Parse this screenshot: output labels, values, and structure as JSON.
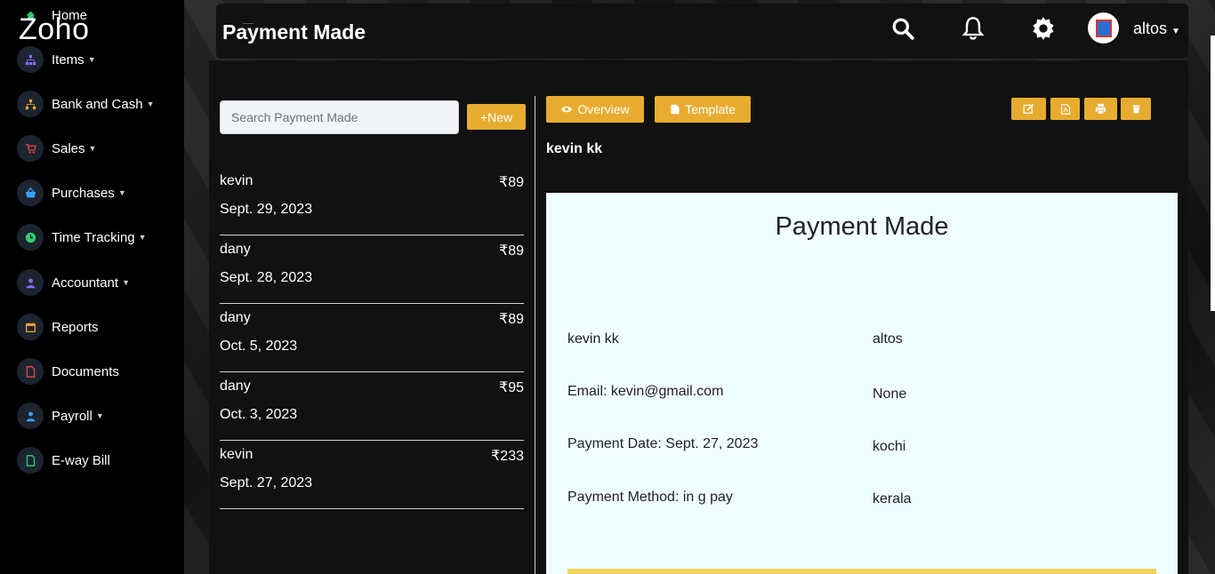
{
  "sidebar": {
    "logo": "Zoho",
    "items": [
      {
        "label": "Home",
        "icon": "home-icon",
        "color": "#2ecc71",
        "caret": false
      },
      {
        "label": "Items",
        "icon": "sitemap-icon",
        "color": "#8a6bf0",
        "caret": true
      },
      {
        "label": "Bank and Cash",
        "icon": "bank-icon",
        "color": "#f0a030",
        "caret": true
      },
      {
        "label": "Sales",
        "icon": "cart-icon",
        "color": "#e84545",
        "caret": true
      },
      {
        "label": "Purchases",
        "icon": "basket-icon",
        "color": "#3aa0ff",
        "caret": true
      },
      {
        "label": "Time Tracking",
        "icon": "clock-icon",
        "color": "#2ecc71",
        "caret": true
      },
      {
        "label": "Accountant",
        "icon": "user-icon",
        "color": "#8a6bf0",
        "caret": true
      },
      {
        "label": "Reports",
        "icon": "calendar-icon",
        "color": "#f0a030",
        "caret": false
      },
      {
        "label": "Documents",
        "icon": "document-icon",
        "color": "#e84545",
        "caret": false
      },
      {
        "label": "Payroll",
        "icon": "person-icon",
        "color": "#3aa0ff",
        "caret": true
      },
      {
        "label": "E-way Bill",
        "icon": "file-icon",
        "color": "#2ecc71",
        "caret": false
      }
    ]
  },
  "header": {
    "title": "Payment Made",
    "user": "altos"
  },
  "search": {
    "placeholder": "Search Payment Made",
    "value": ""
  },
  "new_button": "+New",
  "payments": [
    {
      "name": "kevin",
      "amount": "₹89",
      "date": "Sept. 29, 2023"
    },
    {
      "name": "dany",
      "amount": "₹89",
      "date": "Sept. 28, 2023"
    },
    {
      "name": "dany",
      "amount": "₹89",
      "date": "Oct. 5, 2023"
    },
    {
      "name": "dany",
      "amount": "₹95",
      "date": "Oct. 3, 2023"
    },
    {
      "name": "kevin",
      "amount": "₹233",
      "date": "Sept. 27, 2023"
    }
  ],
  "detail": {
    "overview_label": "Overview",
    "template_label": "Template",
    "contact": "kevin  kk",
    "doc_title": "Payment Made",
    "left": [
      "kevin  kk",
      "Email: kevin@gmail.com",
      "Payment Date: Sept. 27, 2023",
      "Payment Method: in g pay"
    ],
    "right": [
      "altos",
      "None",
      "kochi",
      "kerala"
    ]
  },
  "colors": {
    "accent": "#e7ac2f",
    "doc_bg": "#f0fdff",
    "sidebar_bg": "#000000"
  }
}
